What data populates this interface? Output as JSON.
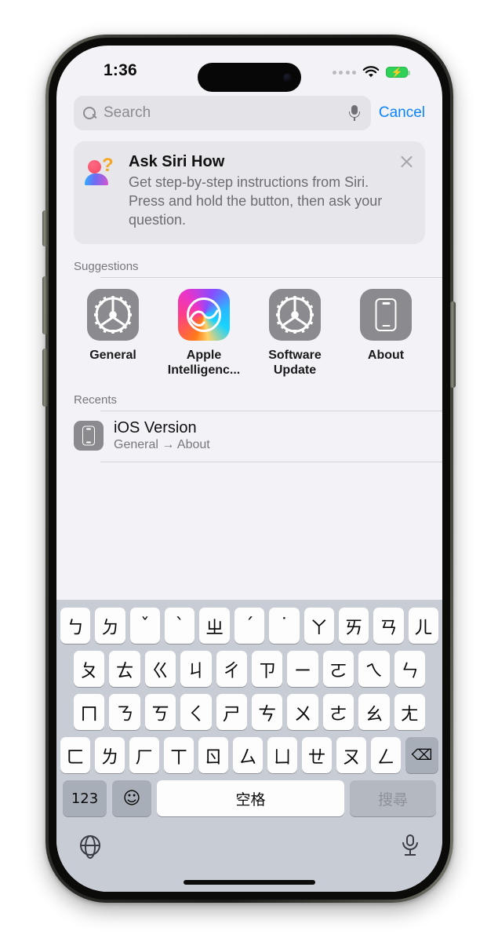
{
  "status_bar": {
    "time": "1:36",
    "cellular_icon": "signal-dots-icon",
    "wifi_icon": "wifi-icon",
    "battery_icon": "battery-charging-icon",
    "battery_charging_glyph": "⚡"
  },
  "search": {
    "placeholder": "Search",
    "value": "",
    "search_icon": "search-icon",
    "dictate_icon": "microphone-icon",
    "cancel_label": "Cancel"
  },
  "siri_card": {
    "icon": "siri-person-question-icon",
    "title": "Ask Siri How",
    "body": "Get step-by-step instructions from Siri. Press and hold the  button, then ask your question.",
    "close_icon": "close-icon"
  },
  "suggestions": {
    "header": "Suggestions",
    "items": [
      {
        "label": "General",
        "icon": "gear-icon"
      },
      {
        "label": "Apple Intelligenc...",
        "icon": "apple-intelligence-icon"
      },
      {
        "label": "Software Update",
        "icon": "gear-icon"
      },
      {
        "label": "About",
        "icon": "iphone-icon"
      }
    ]
  },
  "recents": {
    "header": "Recents",
    "items": [
      {
        "title": "iOS Version",
        "subtitle": "General → About",
        "icon": "iphone-icon"
      }
    ]
  },
  "keyboard": {
    "layout_name": "zhuyin-bopomofo",
    "rows": [
      [
        "ㄅ",
        "ㄉ",
        "ˇ",
        "ˋ",
        "ㄓ",
        "ˊ",
        "˙",
        "ㄚ",
        "ㄞ",
        "ㄢ",
        "ㄦ"
      ],
      [
        "ㄆ",
        "ㄊ",
        "ㄍ",
        "ㄐ",
        "ㄔ",
        "ㄗ",
        "ㄧ",
        "ㄛ",
        "ㄟ",
        "ㄣ"
      ],
      [
        "ㄇ",
        "ㄋ",
        "ㄎ",
        "ㄑ",
        "ㄕ",
        "ㄘ",
        "ㄨ",
        "ㄜ",
        "ㄠ",
        "ㄤ"
      ],
      [
        "ㄈ",
        "ㄌ",
        "ㄏ",
        "ㄒ",
        "ㄖ",
        "ㄙ",
        "ㄩ",
        "ㄝ",
        "ㄡ",
        "ㄥ"
      ]
    ],
    "backspace_label": "⌫",
    "numbers_label": "123",
    "emoji_label": "☺",
    "space_label": "空格",
    "return_label": "搜尋",
    "globe_icon": "globe-icon",
    "dictate_icon": "microphone-icon"
  },
  "colors": {
    "accent_blue": "#0a84ff",
    "screen_bg": "#f2f2f7",
    "keyboard_bg": "#c8ccd4",
    "icon_grey": "#8a8a8f",
    "battery_green": "#30d158"
  }
}
